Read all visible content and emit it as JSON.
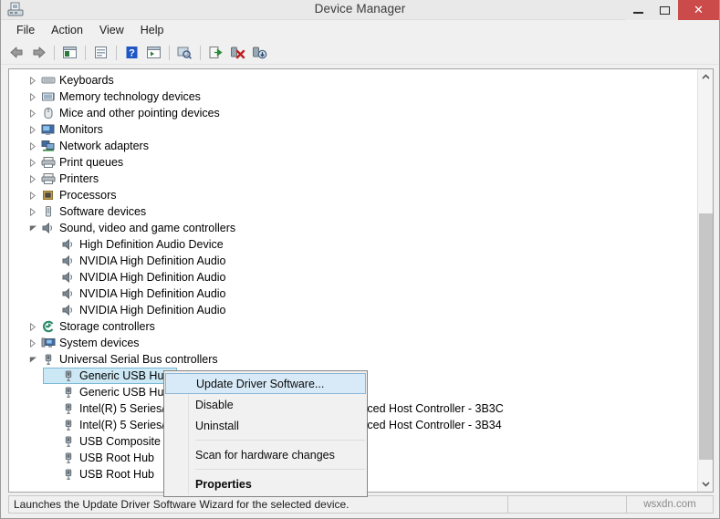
{
  "window": {
    "title": "Device Manager",
    "icon": "device-manager-icon",
    "minimize_label": "—",
    "maximize_label": "□",
    "close_label": "✕"
  },
  "menubar": {
    "items": [
      {
        "label": "File",
        "name": "menu-file"
      },
      {
        "label": "Action",
        "name": "menu-action"
      },
      {
        "label": "View",
        "name": "menu-view"
      },
      {
        "label": "Help",
        "name": "menu-help"
      }
    ]
  },
  "toolbar": {
    "buttons": [
      {
        "name": "back-icon",
        "tip": "Back"
      },
      {
        "name": "forward-icon",
        "tip": "Forward"
      },
      {
        "name": "show-hide-console-tree-icon",
        "tip": "Show/Hide Console Tree"
      },
      {
        "name": "properties-icon",
        "tip": "Properties"
      },
      {
        "name": "help-icon",
        "tip": "Help"
      },
      {
        "name": "show-hide-action-pane-icon",
        "tip": "Show/Hide Action Pane"
      },
      {
        "name": "scan-for-hardware-changes-icon",
        "tip": "Scan for hardware changes"
      },
      {
        "name": "update-driver-software-icon",
        "tip": "Update Driver Software"
      },
      {
        "name": "uninstall-device-icon",
        "tip": "Uninstall"
      },
      {
        "name": "disable-device-icon",
        "tip": "Disable"
      }
    ]
  },
  "tree": {
    "rows": [
      {
        "label": "Keyboards",
        "level": 1,
        "twisty": "collapsed",
        "icon": "keyboard-icon"
      },
      {
        "label": "Memory technology devices",
        "level": 1,
        "twisty": "collapsed",
        "icon": "memory-device-icon"
      },
      {
        "label": "Mice and other pointing devices",
        "level": 1,
        "twisty": "collapsed",
        "icon": "mouse-icon"
      },
      {
        "label": "Monitors",
        "level": 1,
        "twisty": "collapsed",
        "icon": "monitor-icon"
      },
      {
        "label": "Network adapters",
        "level": 1,
        "twisty": "collapsed",
        "icon": "network-adapter-icon"
      },
      {
        "label": "Print queues",
        "level": 1,
        "twisty": "collapsed",
        "icon": "printer-icon"
      },
      {
        "label": "Printers",
        "level": 1,
        "twisty": "collapsed",
        "icon": "printer-icon"
      },
      {
        "label": "Processors",
        "level": 1,
        "twisty": "collapsed",
        "icon": "processor-icon"
      },
      {
        "label": "Software devices",
        "level": 1,
        "twisty": "collapsed",
        "icon": "software-device-icon"
      },
      {
        "label": "Sound, video and game controllers",
        "level": 1,
        "twisty": "expanded",
        "icon": "speaker-icon"
      },
      {
        "label": "High Definition Audio Device",
        "level": 2,
        "twisty": "none",
        "icon": "speaker-icon"
      },
      {
        "label": "NVIDIA High Definition Audio",
        "level": 2,
        "twisty": "none",
        "icon": "speaker-icon"
      },
      {
        "label": "NVIDIA High Definition Audio",
        "level": 2,
        "twisty": "none",
        "icon": "speaker-icon"
      },
      {
        "label": "NVIDIA High Definition Audio",
        "level": 2,
        "twisty": "none",
        "icon": "speaker-icon"
      },
      {
        "label": "NVIDIA High Definition Audio",
        "level": 2,
        "twisty": "none",
        "icon": "speaker-icon"
      },
      {
        "label": "Storage controllers",
        "level": 1,
        "twisty": "collapsed",
        "icon": "storage-controller-icon"
      },
      {
        "label": "System devices",
        "level": 1,
        "twisty": "collapsed",
        "icon": "system-device-icon"
      },
      {
        "label": "Universal Serial Bus controllers",
        "level": 1,
        "twisty": "expanded",
        "icon": "usb-icon"
      },
      {
        "label": "Generic USB Hub",
        "level": 2,
        "twisty": "none",
        "icon": "usb-icon",
        "selected": true
      },
      {
        "label": "Generic USB Hub",
        "level": 2,
        "twisty": "none",
        "icon": "usb-icon"
      },
      {
        "label": "Intel(R) 5 Series/3400 Series Chipset Family USB Enhanced Host Controller - 3B3C",
        "level": 2,
        "twisty": "none",
        "icon": "usb-icon"
      },
      {
        "label": "Intel(R) 5 Series/3400 Series Chipset Family USB Enhanced Host Controller - 3B34",
        "level": 2,
        "twisty": "none",
        "icon": "usb-icon"
      },
      {
        "label": "USB Composite Device",
        "level": 2,
        "twisty": "none",
        "icon": "usb-icon"
      },
      {
        "label": "USB Root Hub",
        "level": 2,
        "twisty": "none",
        "icon": "usb-icon"
      },
      {
        "label": "USB Root Hub",
        "level": 2,
        "twisty": "none",
        "icon": "usb-icon"
      }
    ]
  },
  "context_menu": {
    "items": [
      {
        "label": "Update Driver Software...",
        "kind": "item",
        "highlight": true,
        "bold": false
      },
      {
        "label": "Disable",
        "kind": "item",
        "highlight": false,
        "bold": false
      },
      {
        "label": "Uninstall",
        "kind": "item",
        "highlight": false,
        "bold": false
      },
      {
        "kind": "separator"
      },
      {
        "label": "Scan for hardware changes",
        "kind": "item",
        "highlight": false,
        "bold": false
      },
      {
        "kind": "separator"
      },
      {
        "label": "Properties",
        "kind": "item",
        "highlight": false,
        "bold": true
      }
    ]
  },
  "statusbar": {
    "message": "Launches the Update Driver Software Wizard for the selected device.",
    "watermark": "wsxdn.com"
  },
  "colors": {
    "selection_fill": "#cce8f4",
    "selection_border": "#7ab8d3",
    "menu_highlight": "#d8eaf7",
    "close_button": "#cb4b4b",
    "chrome": "#f0f0f0"
  }
}
